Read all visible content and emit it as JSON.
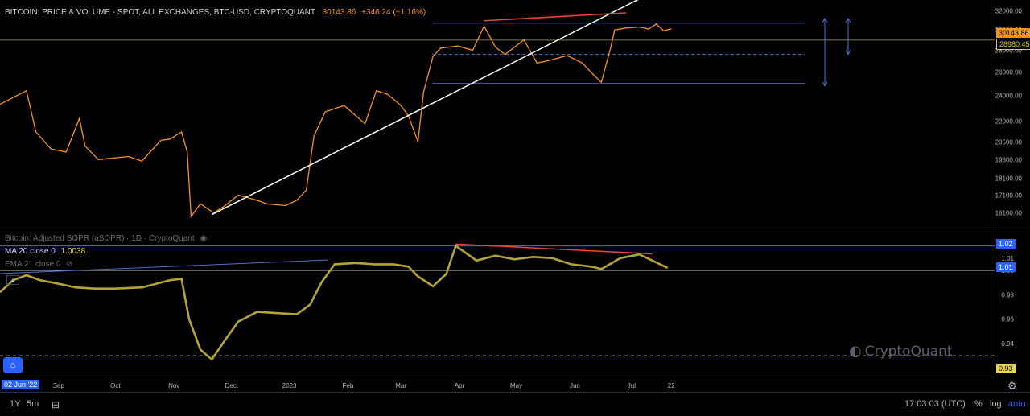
{
  "header": {
    "price_title": "BITCOIN: PRICE & VOLUME - SPOT, ALL EXCHANGES, BTC-USD, CRYPTOQUANT",
    "price_value": "30143.86",
    "price_change": "+346.24 (+1.16%)",
    "sopr_title": "Bitcoin: Adjusted SOPR (aSOPR) · 1D · CryptoQuant",
    "ma_label": "MA 20 close 0",
    "ma_value": "1.0038",
    "ema_label": "EMA 21 close 0"
  },
  "watermark": "CryptoQuant",
  "bottom_bar": {
    "range_1y": "1Y",
    "range_5m": "5m",
    "time": "17:03:03 (UTC)",
    "pct": "%",
    "log": "log",
    "auto": "auto"
  },
  "date_tag": "02 Jun '22",
  "price_tags": {
    "current": "30143.86",
    "level": "28980.45"
  },
  "sopr_tags": {
    "top": "1.02",
    "current": "1.01",
    "low": "0.93"
  },
  "colors": {
    "price_line": "#f7931a",
    "sopr_line": "#b5a432",
    "trend": "#ffffff",
    "divergence": "#f44336",
    "level_blue": "#4a6fd8",
    "level_yellow": "#d4c95a"
  },
  "chart_data": [
    {
      "type": "line",
      "title": "BITCOIN: PRICE & VOLUME - SPOT, ALL EXCHANGES, BTC-USD, CRYPTOQUANT",
      "x_labels": [
        "Sep",
        "Oct",
        "Nov",
        "Dec",
        "2023",
        "Feb",
        "Mar",
        "Apr",
        "May",
        "Jun",
        "Jul",
        "22"
      ],
      "y_ticks": [
        16100,
        17100,
        18100,
        19300,
        20500,
        22000,
        24000,
        26000,
        28000,
        30000,
        32000
      ],
      "ylim": [
        15600,
        32500
      ],
      "log_scale": true,
      "series": [
        {
          "x": [
            "2022-08-01",
            "2022-08-10",
            "2022-08-15",
            "2022-08-20",
            "2022-08-28",
            "2022-09-05",
            "2022-09-12",
            "2022-09-15",
            "2022-09-22",
            "2022-09-30",
            "2022-10-08",
            "2022-10-15",
            "2022-10-25",
            "2022-10-30",
            "2022-11-05",
            "2022-11-08",
            "2022-11-10",
            "2022-11-15",
            "2022-11-22",
            "2022-11-28",
            "2022-12-05",
            "2022-12-15",
            "2022-12-20",
            "2022-12-30",
            "2023-01-05",
            "2023-01-10",
            "2023-01-14",
            "2023-01-20",
            "2023-01-30",
            "2023-02-10",
            "2023-02-16",
            "2023-02-22",
            "2023-03-01",
            "2023-03-05",
            "2023-03-10",
            "2023-03-13",
            "2023-03-18",
            "2023-03-22",
            "2023-03-31",
            "2023-04-08",
            "2023-04-14",
            "2023-04-20",
            "2023-04-25",
            "2023-05-05",
            "2023-05-12",
            "2023-05-20",
            "2023-05-28",
            "2023-06-05",
            "2023-06-10",
            "2023-06-15",
            "2023-06-20",
            "2023-06-22",
            "2023-06-28",
            "2023-07-05",
            "2023-07-10",
            "2023-07-14",
            "2023-07-18",
            "2023-07-22"
          ],
          "values": [
            23300,
            24000,
            24400,
            21200,
            20000,
            19800,
            22200,
            20200,
            19300,
            19400,
            19500,
            19200,
            20600,
            20700,
            21200,
            19800,
            15900,
            16600,
            16100,
            16500,
            17100,
            16800,
            16600,
            16500,
            16800,
            17400,
            20900,
            22700,
            23200,
            21800,
            24400,
            24100,
            23200,
            22400,
            20500,
            24300,
            27400,
            28200,
            28400,
            28000,
            30400,
            28300,
            27600,
            29000,
            26800,
            27100,
            27500,
            26800,
            25900,
            25100,
            28300,
            30000,
            30200,
            30300,
            30100,
            30600,
            29900,
            30143.86
          ]
        }
      ],
      "annotations": {
        "resistance_level": 30700,
        "mid_level": 27600,
        "support_level": 25000,
        "current_line": 28980.45
      }
    },
    {
      "type": "line",
      "title": "Bitcoin: Adjusted SOPR (aSOPR) · 1D · CryptoQuant",
      "y_ticks": [
        0.92,
        0.94,
        0.96,
        0.98,
        1.0,
        1.01,
        1.02
      ],
      "ylim": [
        0.915,
        1.025
      ],
      "series": [
        {
          "x": [
            "2022-08-01",
            "2022-08-08",
            "2022-08-15",
            "2022-08-22",
            "2022-09-01",
            "2022-09-10",
            "2022-09-20",
            "2022-10-01",
            "2022-10-15",
            "2022-10-30",
            "2022-11-05",
            "2022-11-09",
            "2022-11-15",
            "2022-11-21",
            "2022-11-28",
            "2022-12-05",
            "2022-12-15",
            "2022-12-25",
            "2023-01-05",
            "2023-01-12",
            "2023-01-18",
            "2023-01-25",
            "2023-02-05",
            "2023-02-15",
            "2023-02-25",
            "2023-03-05",
            "2023-03-10",
            "2023-03-18",
            "2023-03-25",
            "2023-03-30",
            "2023-04-10",
            "2023-04-20",
            "2023-04-30",
            "2023-05-10",
            "2023-05-20",
            "2023-05-30",
            "2023-06-10",
            "2023-06-15",
            "2023-06-25",
            "2023-07-05",
            "2023-07-12",
            "2023-07-20"
          ],
          "values": [
            0.982,
            0.992,
            0.996,
            0.992,
            0.989,
            0.986,
            0.985,
            0.985,
            0.986,
            0.992,
            0.993,
            0.96,
            0.935,
            0.927,
            0.943,
            0.958,
            0.966,
            0.965,
            0.964,
            0.972,
            0.99,
            1.005,
            1.006,
            1.005,
            1.005,
            1.003,
            0.995,
            0.987,
            0.997,
            1.02,
            1.008,
            1.012,
            1.009,
            1.011,
            1.01,
            1.005,
            1.003,
            1.001,
            1.01,
            1.013,
            1.008,
            1.002
          ]
        }
      ],
      "annotations": {
        "top_level": 1.02,
        "base_level": 1.0,
        "low_level": 0.93
      }
    }
  ]
}
